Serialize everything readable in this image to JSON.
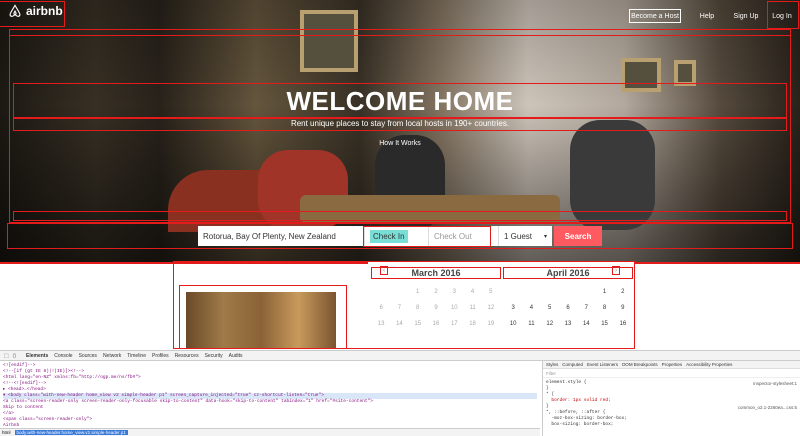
{
  "topbar": {
    "logo_text": "airbnb",
    "become_host": "Become a Host",
    "help": "Help",
    "signup": "Sign Up",
    "login": "Log In"
  },
  "hero": {
    "title": "WELCOME HOME",
    "subtitle": "Rent unique places to stay from local hosts in 190+ countries.",
    "how_it_works": "How It Works"
  },
  "search": {
    "location": "Rotorua, Bay Of Plenty, New Zealand",
    "checkin": "Check In",
    "checkout": "Check Out",
    "guests": "1 Guest",
    "button": "Search"
  },
  "calendar": {
    "months": [
      {
        "title": "March 2016",
        "days": [
          "",
          "",
          "1",
          "2",
          "3",
          "4",
          "5",
          "6",
          "7",
          "8",
          "9",
          "10",
          "11",
          "12",
          "13",
          "14",
          "15",
          "16",
          "17",
          "18",
          "19"
        ]
      },
      {
        "title": "April 2016",
        "days": [
          "",
          "",
          "",
          "",
          "",
          "1",
          "2",
          "3",
          "4",
          "5",
          "6",
          "7",
          "8",
          "9",
          "10",
          "11",
          "12",
          "13",
          "14",
          "15",
          "16"
        ]
      }
    ]
  },
  "devtools": {
    "tabs": [
      "Elements",
      "Console",
      "Sources",
      "Network",
      "Timeline",
      "Profiles",
      "Resources",
      "Security",
      "Audits"
    ],
    "dom_lines": [
      "<![endif]-->",
      "<!--[if (gt IE 8)|!(IE)]><!-->",
      "<html lang=\"en-NZ\" xmlns:fb=\"http://ogp.me/ns/fb#\">",
      "<!--<![endif]-->",
      "▸ <head>…</head>",
      "▾ <body class=\"with-new-header home_view v2 simple-header p1\" screen_capture_injected=\"true\" cz-shortcut-listen=\"true\">",
      "  <a class=\"screen-reader-only screen-reader-only-focusable skip-to-content\" data-hook=\"skip-to-content\" tabindex=\"1\" href=\"#site-content\">",
      "    Skip to content",
      "  </a>",
      "  <span class=\"screen-reader-only\">",
      "    Airbnb"
    ],
    "breadcrumb": [
      "html",
      "body.with-new-header.home_view.v2.simple-header.p1"
    ],
    "styles_tabs": [
      "Styles",
      "Computed",
      "Event Listeners",
      "DOM Breakpoints",
      "Properties",
      "Accessibility Properties"
    ],
    "filter_placeholder": "Filter",
    "style_lines": [
      "element.style {",
      "}",
      "* {",
      "  border: 1px solid red;",
      "}",
      "*, ::before, ::after {",
      "  -moz-box-sizing: border-box;",
      "  box-sizing: border-box;"
    ],
    "stylesheet_link": "inspector-stylesheet:1",
    "common_link": "common_o2.1-2260ea...css:5"
  },
  "colors": {
    "accent": "#ff5a5f",
    "debug_outline": "#e31b1b"
  }
}
